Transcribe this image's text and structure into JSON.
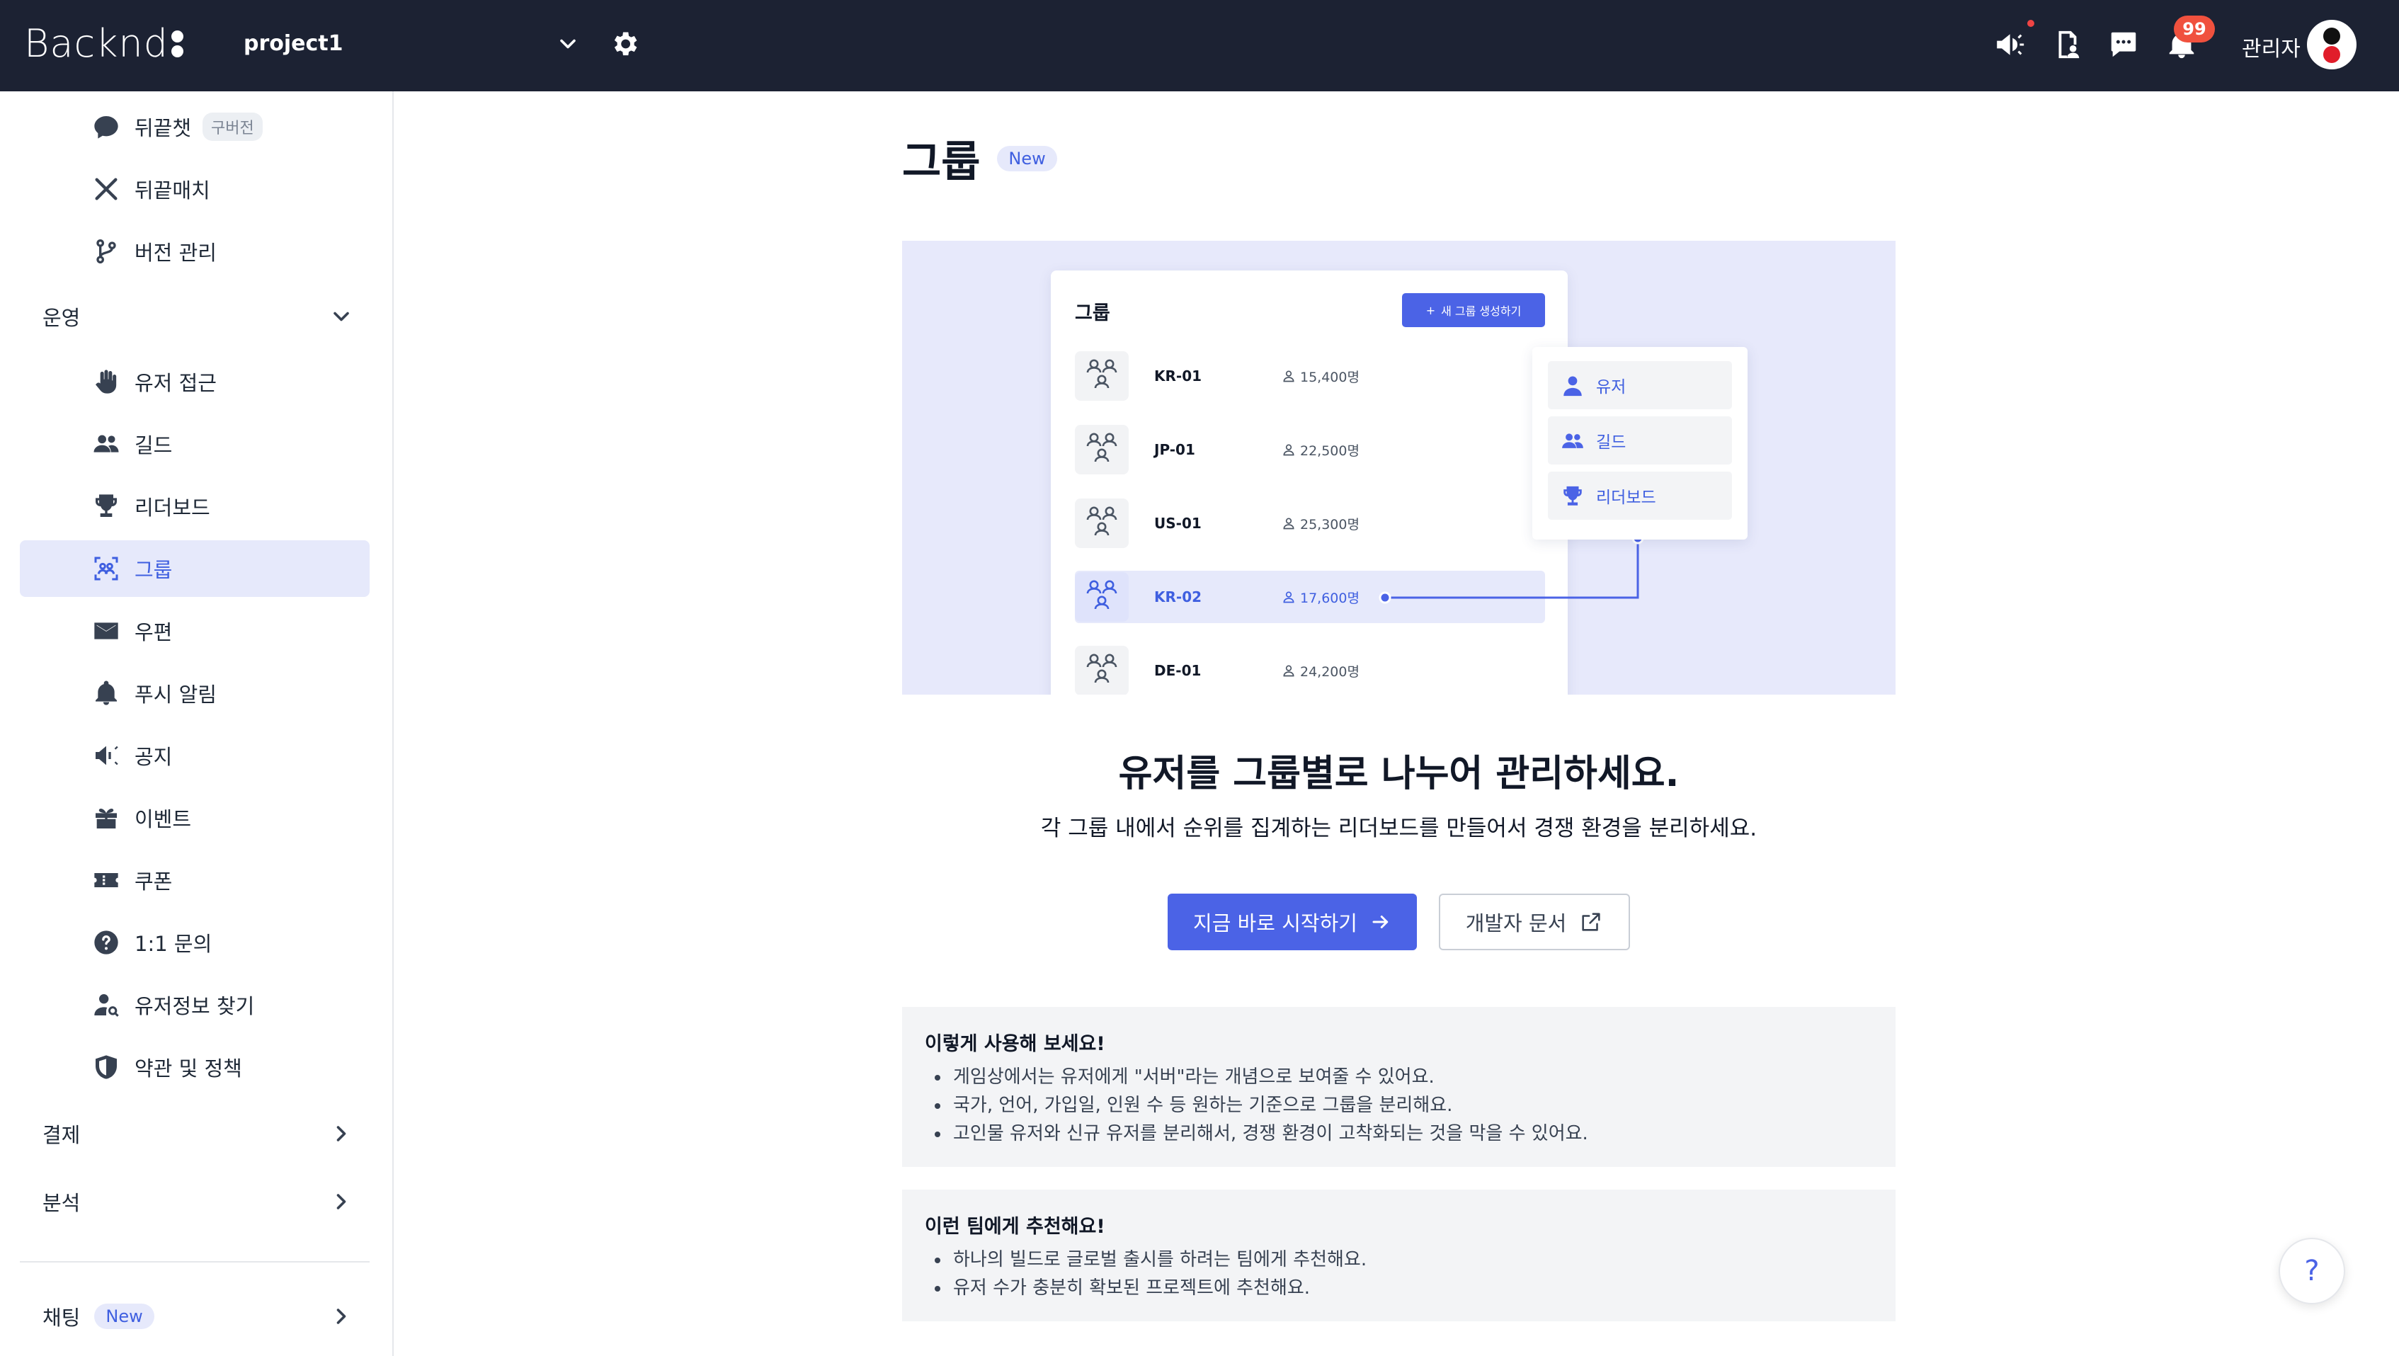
{
  "header": {
    "logo_text": "Backnd",
    "project_name": "project1",
    "notification_count": "99",
    "admin_label": "관리자"
  },
  "sidebar": {
    "items_top": [
      {
        "label": "뒤끝챗",
        "tag": "구버전",
        "icon": "chat-bubble-icon"
      },
      {
        "label": "뒤끝매치",
        "icon": "crossed-swords-icon"
      },
      {
        "label": "버전 관리",
        "icon": "branch-icon"
      }
    ],
    "group_ops": {
      "label": "운영"
    },
    "items_ops": [
      {
        "label": "유저 접근",
        "icon": "hand-icon"
      },
      {
        "label": "길드",
        "icon": "users-icon"
      },
      {
        "label": "리더보드",
        "icon": "trophy-icon"
      },
      {
        "label": "그룹",
        "icon": "group-scan-icon",
        "active": true
      },
      {
        "label": "우편",
        "icon": "mail-icon"
      },
      {
        "label": "푸시 알림",
        "icon": "bell-icon"
      },
      {
        "label": "공지",
        "icon": "megaphone-icon"
      },
      {
        "label": "이벤트",
        "icon": "gift-icon"
      },
      {
        "label": "쿠폰",
        "icon": "ticket-icon"
      },
      {
        "label": "1:1 문의",
        "icon": "question-circle-icon"
      },
      {
        "label": "유저정보 찾기",
        "icon": "user-search-icon"
      },
      {
        "label": "약관 및 정책",
        "icon": "shield-icon"
      }
    ],
    "group_payment": {
      "label": "결제"
    },
    "group_analytics": {
      "label": "분석"
    },
    "group_chat": {
      "label": "채팅",
      "tag": "New"
    }
  },
  "main": {
    "title": "그룹",
    "title_tag": "New",
    "preview": {
      "card_title": "그룹",
      "new_button": "새 그룹 생성하기",
      "rows": [
        {
          "code": "KR-01",
          "count": "15,400명"
        },
        {
          "code": "JP-01",
          "count": "22,500명"
        },
        {
          "code": "US-01",
          "count": "25,300명"
        },
        {
          "code": "KR-02",
          "count": "17,600명",
          "highlight": true
        },
        {
          "code": "DE-01",
          "count": "24,200명"
        }
      ],
      "menu": [
        {
          "label": "유저",
          "icon": "user-icon"
        },
        {
          "label": "길드",
          "icon": "users-icon"
        },
        {
          "label": "리더보드",
          "icon": "trophy-icon"
        }
      ]
    },
    "headline": "유저를 그룹별로 나누어 관리하세요.",
    "subline": "각 그룹 내에서 순위를 집계하는 리더보드를 만들어서 경쟁 환경을 분리하세요.",
    "start_button": "지금 바로 시작하기",
    "docs_button": "개발자 문서",
    "usage": {
      "title": "이렇게 사용해 보세요!",
      "bullets": [
        "게임상에서는 유저에게 \"서버\"라는 개념으로 보여줄 수 있어요.",
        "국가, 언어, 가입일, 인원 수 등 원하는 기준으로 그룹을 분리해요.",
        "고인물 유저와 신규 유저를 분리해서, 경쟁 환경이 고착화되는 것을 막을 수 있어요."
      ]
    },
    "recommend": {
      "title": "이런 팀에게 추천해요!",
      "bullets": [
        "하나의 빌드로 글로벌 출시를 하려는 팀에게 추천해요.",
        "유저 수가 충분히 확보된 프로젝트에 추천해요."
      ]
    },
    "help_label": "?"
  },
  "colors": {
    "topbar": "#1c2233",
    "accent": "#4b63e6",
    "active_bg": "#e6e9fb",
    "hero_bg": "#e7e9fb",
    "badge": "#f0513e"
  }
}
